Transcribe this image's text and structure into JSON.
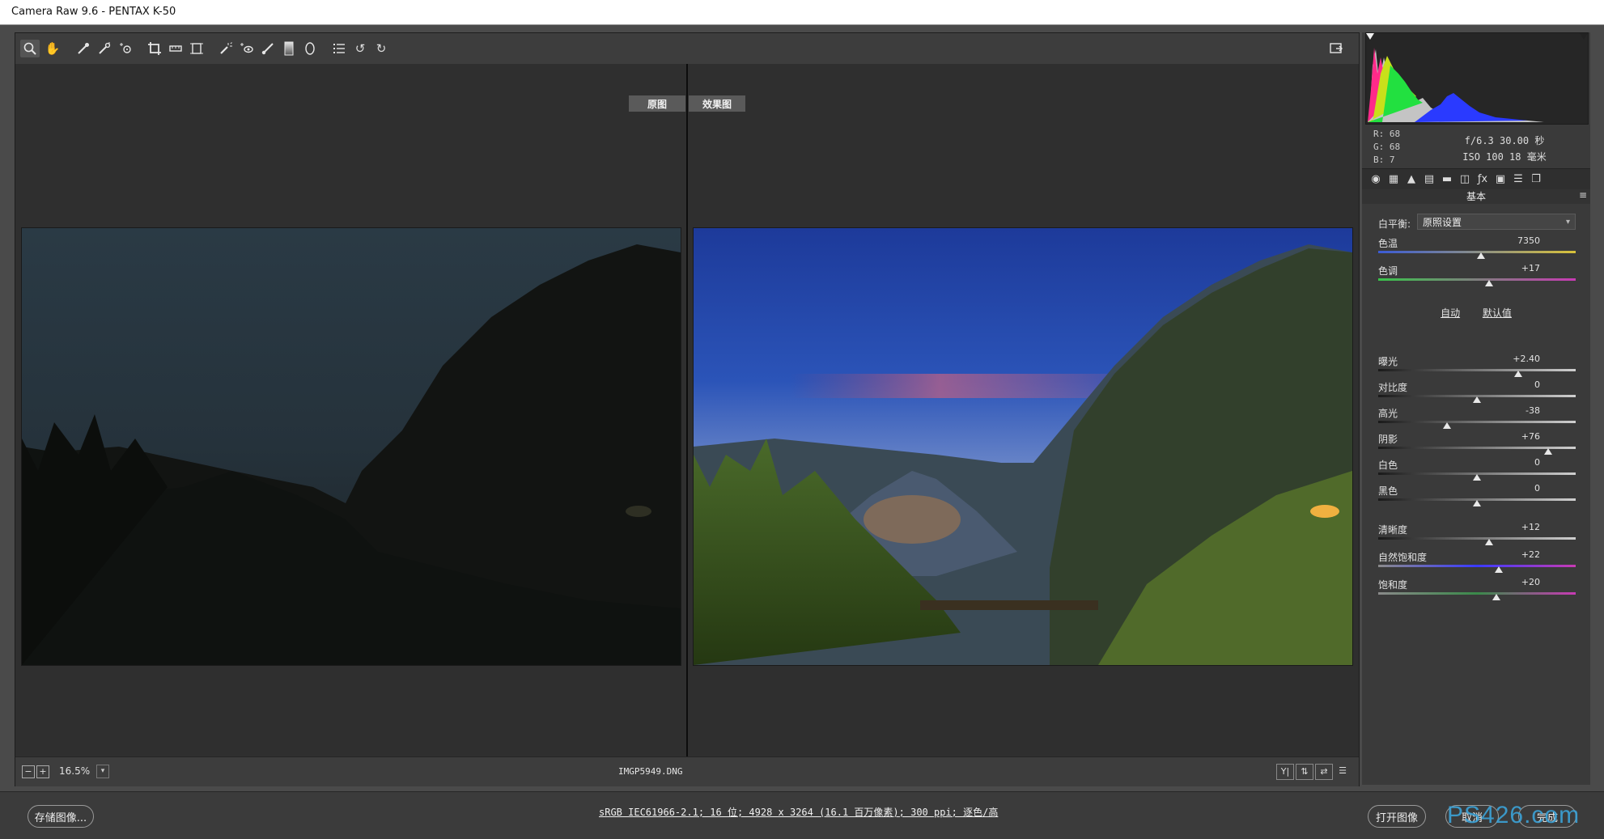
{
  "window": {
    "title": "Camera Raw 9.6 -  PENTAX K-50"
  },
  "preview": {
    "before_label": "原图",
    "after_label": "效果图"
  },
  "status": {
    "zoom": "16.5%",
    "filename": "IMGP5949.DNG"
  },
  "bottom": {
    "save_label": "存储图像...",
    "info_link": "sRGB IEC61966-2.1; 16 位; 4928 x 3264 (16.1 百万像素); 300 ppi; 逐色/高",
    "open_label": "打开图像",
    "cancel_label": "取消",
    "done_label": "完成",
    "watermark": "PS426.com"
  },
  "readout": {
    "r": "R:   68",
    "g": "G:   68",
    "b": "B:    7",
    "exif_line1": "f/6.3  30.00 秒",
    "exif_line2": "ISO 100  18 毫米"
  },
  "panel": {
    "section_title": "基本",
    "wb_label": "白平衡:",
    "wb_value": "原照设置",
    "auto_label": "自动",
    "default_label": "默认值",
    "sliders": [
      {
        "label": "色温",
        "value": "7350",
        "fraction": 0.52
      },
      {
        "label": "色调",
        "value": "+17",
        "fraction": 0.56
      },
      {
        "label": "曝光",
        "value": "+2.40",
        "fraction": 0.71
      },
      {
        "label": "对比度",
        "value": "0",
        "fraction": 0.5
      },
      {
        "label": "高光",
        "value": "-38",
        "fraction": 0.35
      },
      {
        "label": "阴影",
        "value": "+76",
        "fraction": 0.86
      },
      {
        "label": "白色",
        "value": "0",
        "fraction": 0.5
      },
      {
        "label": "黑色",
        "value": "0",
        "fraction": 0.5
      },
      {
        "label": "清晰度",
        "value": "+12",
        "fraction": 0.56
      },
      {
        "label": "自然饱和度",
        "value": "+22",
        "fraction": 0.61
      },
      {
        "label": "饱和度",
        "value": "+20",
        "fraction": 0.6
      }
    ]
  },
  "colors": {
    "accent_watermark": "#3ba3d8",
    "temp_track": "#3b5bd6",
    "tint_track": "#38c44a"
  }
}
